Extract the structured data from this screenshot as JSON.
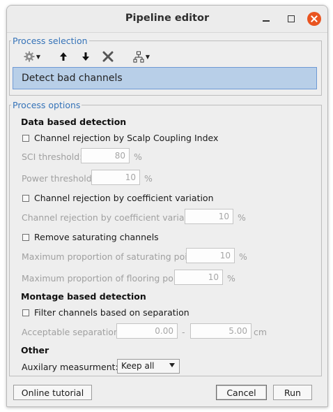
{
  "window": {
    "title": "Pipeline editor",
    "controls": [
      "minimize",
      "maximize",
      "close"
    ],
    "close_color": "#e95420"
  },
  "process_selection": {
    "legend": "Process selection",
    "toolbar": [
      "gear-icon",
      "arrow-up-icon",
      "arrow-down-icon",
      "delete-icon",
      "pipeline-tree-icon"
    ],
    "selected_process": "Detect bad channels",
    "selection_color": "#b8cfe8"
  },
  "process_options": {
    "legend": "Process options",
    "data_based": {
      "title": "Data based detection",
      "sci": {
        "label": "Channel rejection by Scalp Coupling Index",
        "checked": false,
        "sci_threshold_label": "SCI threshold:",
        "sci_threshold_value": "80",
        "sci_threshold_unit": "%",
        "power_threshold_label": "Power threshold:",
        "power_threshold_value": "10",
        "power_threshold_unit": "%"
      },
      "cv": {
        "label": "Channel rejection by coefficient variation",
        "checked": false,
        "field_label": "Channel rejection by coefficient variation",
        "field_value": "10",
        "field_unit": "%"
      },
      "saturating": {
        "label": "Remove saturating channels",
        "checked": false,
        "max_saturating_label": "Maximum proportion of saturating points",
        "max_saturating_value": "10",
        "max_saturating_unit": "%",
        "max_flooring_label": "Maximum proportion of flooring points",
        "max_flooring_value": "10",
        "max_flooring_unit": "%"
      }
    },
    "montage_based": {
      "title": "Montage based detection",
      "separation": {
        "label": "Filter channels based on separation",
        "checked": false,
        "acceptable_label": "Acceptable separation:",
        "min_value": "0.00",
        "dash": "-",
        "max_value": "5.00",
        "unit": "cm"
      }
    },
    "other": {
      "title": "Other",
      "aux_label": "Auxilary measurment:",
      "aux_value": "Keep all"
    }
  },
  "footer": {
    "tutorial_label": "Online tutorial",
    "cancel_label": "Cancel",
    "run_label": "Run"
  }
}
